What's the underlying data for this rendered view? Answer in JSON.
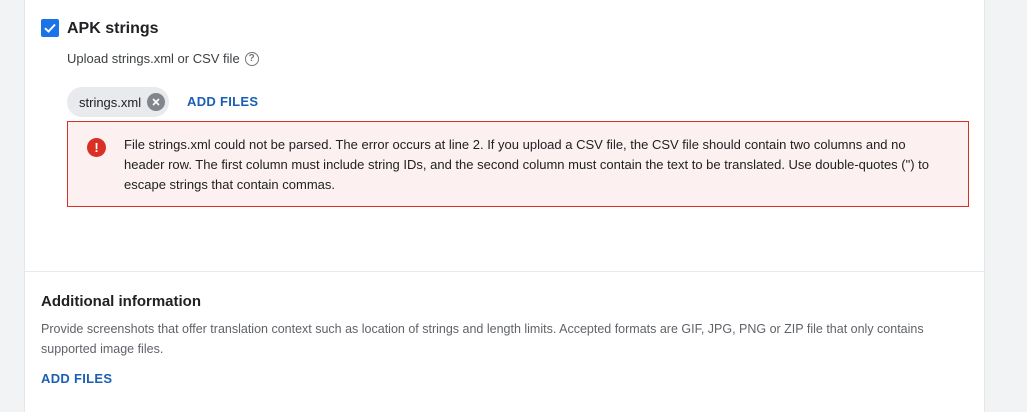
{
  "apk_strings": {
    "title": "APK strings",
    "checked": true,
    "upload_label": "Upload strings.xml or CSV file",
    "help_icon": "question-circle-icon",
    "chip_label": "strings.xml",
    "chip_remove_icon": "close-circle-icon",
    "add_files_label": "ADD FILES",
    "error": {
      "icon": "error-exclamation-icon",
      "message": "File strings.xml could not be parsed. The error occurs at line 2. If you upload a CSV file, the CSV file should contain two columns and no header row. The first column must include string IDs, and the second column must contain the text to be translated. Use double-quotes (\") to escape strings that contain commas."
    }
  },
  "additional_information": {
    "title": "Additional information",
    "description": "Provide screenshots that offer translation context such as location of strings and length limits. Accepted formats are GIF, JPG, PNG or ZIP file that only contains supported image files.",
    "add_files_label": "ADD FILES"
  },
  "colors": {
    "accent": "#1a73e8",
    "link": "#1a5fb4",
    "error": "#d93025",
    "error_bg": "#fcf1f0"
  }
}
